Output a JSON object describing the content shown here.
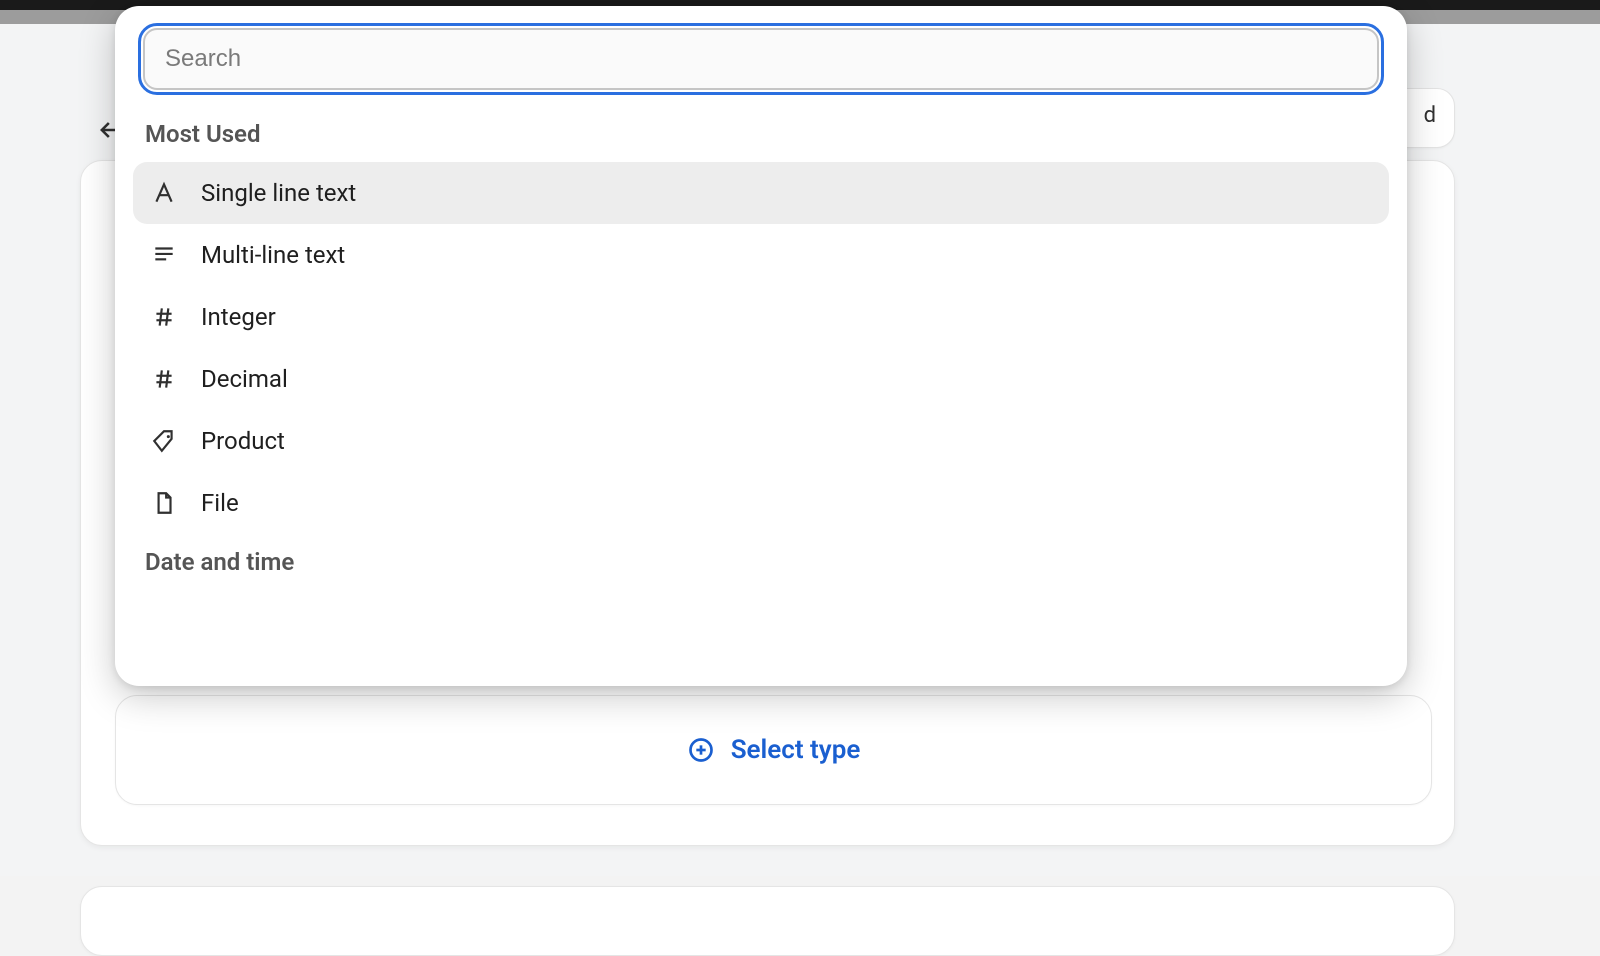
{
  "search": {
    "placeholder": "Search",
    "value": ""
  },
  "back_button_visible_fragment": "d",
  "sections": {
    "most_used": {
      "title": "Most Used",
      "options": [
        {
          "label": "Single line text",
          "icon": "letter-a-icon",
          "highlighted": true
        },
        {
          "label": "Multi-line text",
          "icon": "paragraph-lines-icon",
          "highlighted": false
        },
        {
          "label": "Integer",
          "icon": "hash-icon",
          "highlighted": false
        },
        {
          "label": "Decimal",
          "icon": "hash-icon",
          "highlighted": false
        },
        {
          "label": "Product",
          "icon": "tag-icon",
          "highlighted": false
        },
        {
          "label": "File",
          "icon": "file-icon",
          "highlighted": false
        }
      ]
    },
    "date_time": {
      "title": "Date and time"
    }
  },
  "select_type_button": {
    "label": "Select type"
  }
}
